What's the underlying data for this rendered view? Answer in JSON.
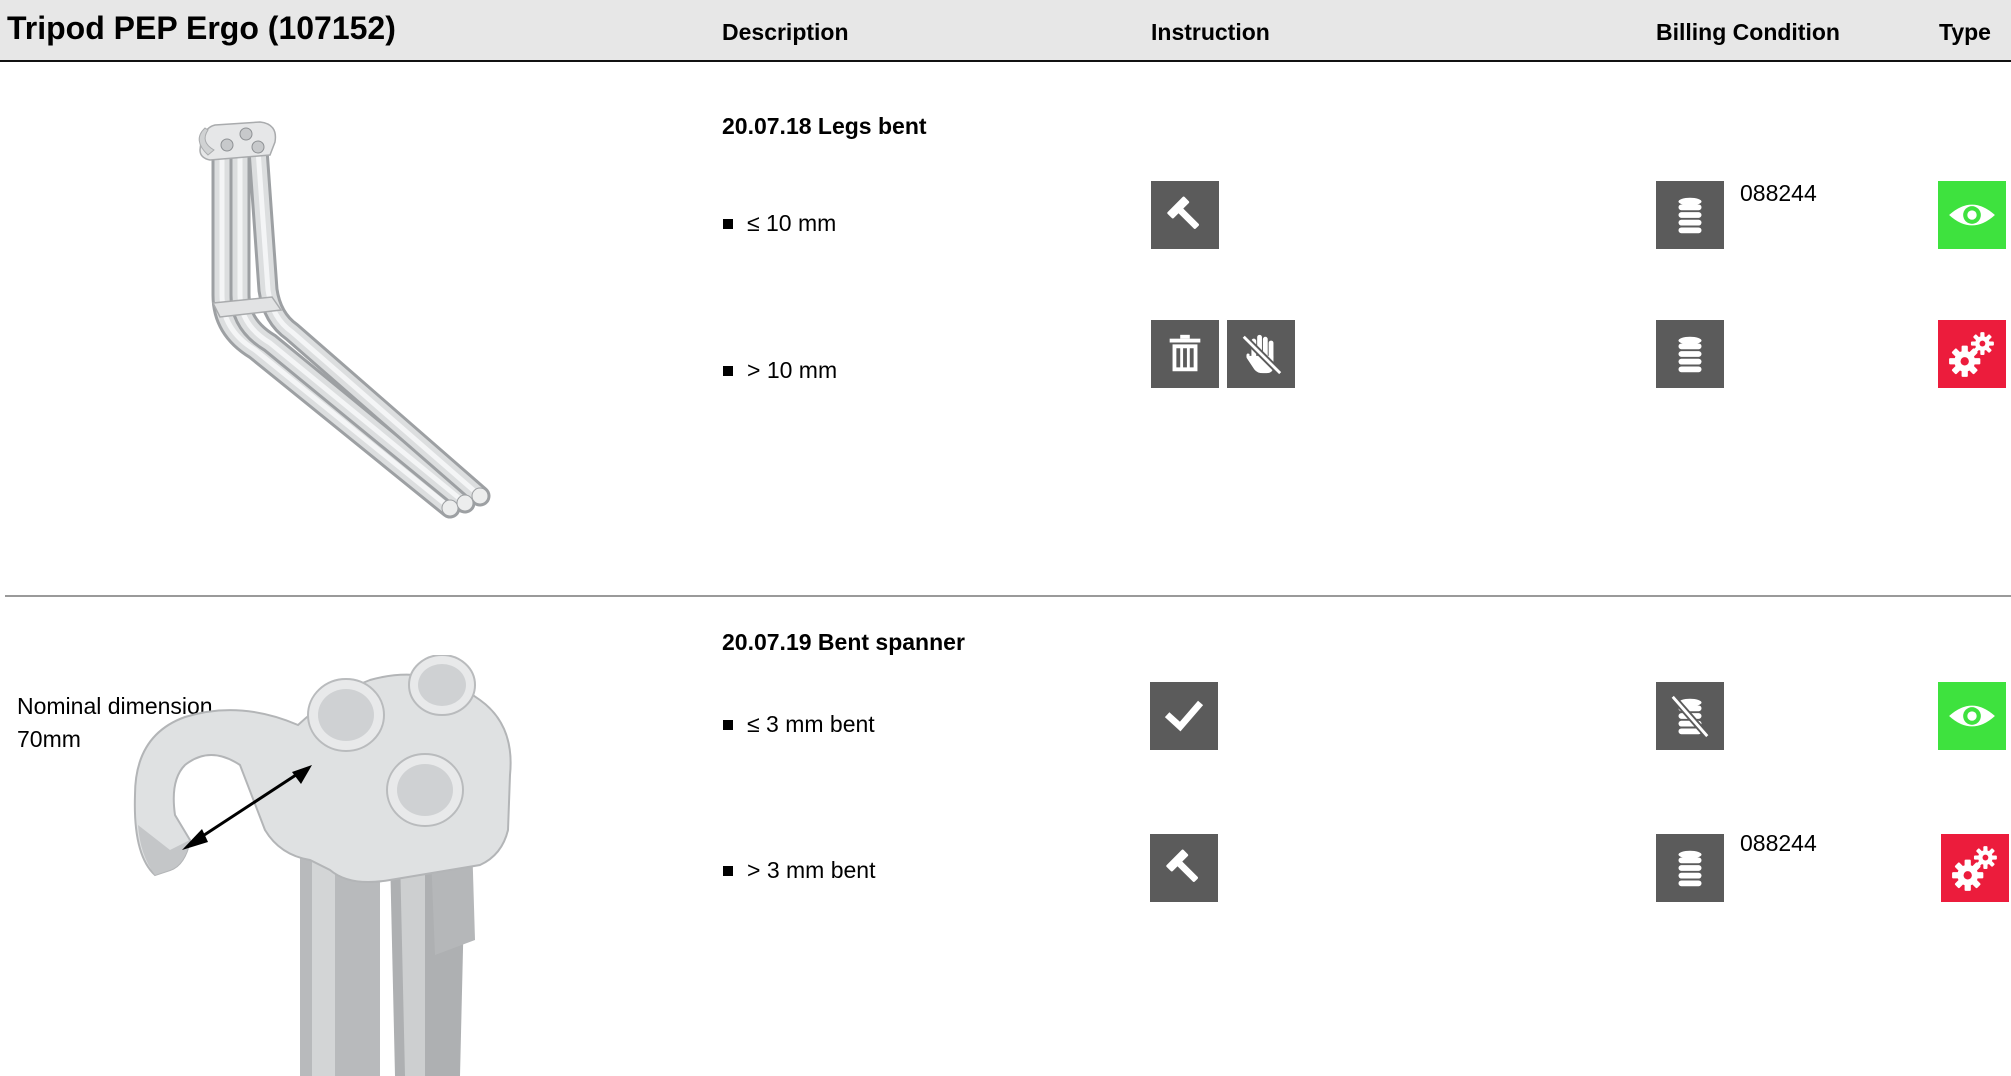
{
  "header": {
    "title": "Tripod PEP Ergo (107152)",
    "col_description": "Description",
    "col_instruction": "Instruction",
    "col_billing": "Billing Condition",
    "col_type": "Type"
  },
  "sections": [
    {
      "title": "20.07.18 Legs bent",
      "rows": [
        {
          "condition": "≤ 10 mm",
          "instruction_icons": [
            "hammer-icon"
          ],
          "billing_icon": "coins-icon",
          "billing_code": "088244",
          "type_icon": "eye-icon",
          "type_color": "#3ee23e"
        },
        {
          "condition": "> 10 mm",
          "instruction_icons": [
            "trash-icon",
            "no-touch-icon"
          ],
          "billing_icon": "coins-icon",
          "billing_code": "",
          "type_icon": "gears-icon",
          "type_color": "#ec1c3c"
        }
      ]
    },
    {
      "title": "20.07.19 Bent spanner",
      "note_line1": "Nominal dimension",
      "note_line2": "70mm",
      "rows": [
        {
          "condition": "≤ 3 mm bent",
          "instruction_icons": [
            "check-icon"
          ],
          "billing_icon": "no-coins-icon",
          "billing_code": "",
          "type_icon": "eye-icon",
          "type_color": "#3ee23e"
        },
        {
          "condition": "> 3 mm bent",
          "instruction_icons": [
            "hammer-icon"
          ],
          "billing_icon": "coins-icon",
          "billing_code": "088244",
          "type_icon": "gears-icon",
          "type_color": "#ec1c3c"
        }
      ]
    }
  ]
}
